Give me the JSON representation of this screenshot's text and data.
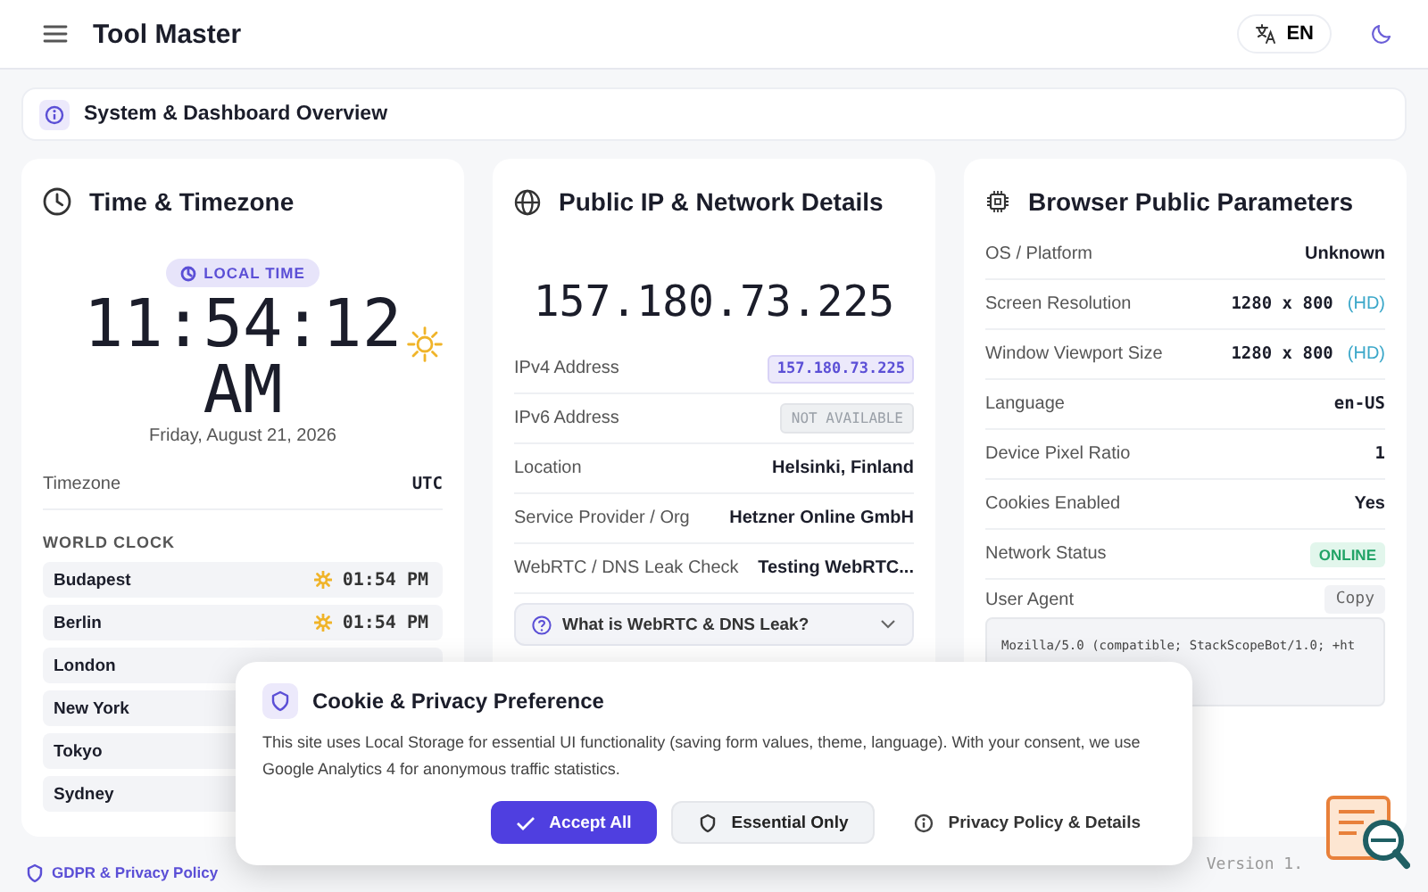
{
  "header": {
    "title": "Tool Master",
    "language": "EN"
  },
  "overview": {
    "title": "System & Dashboard Overview"
  },
  "time_card": {
    "title": "Time & Timezone",
    "badge": "LOCAL TIME",
    "time": "11:54:12",
    "period": "AM",
    "date": "Friday, August 21, 2026",
    "timezone_label": "Timezone",
    "timezone_value": "UTC",
    "world_clock_title": "WORLD CLOCK",
    "cities": [
      {
        "name": "Budapest",
        "time": "01:54 PM"
      },
      {
        "name": "Berlin",
        "time": "01:54 PM"
      },
      {
        "name": "London"
      },
      {
        "name": "New York"
      },
      {
        "name": "Tokyo"
      },
      {
        "name": "Sydney"
      }
    ]
  },
  "ip_card": {
    "title": "Public IP & Network Details",
    "ip": "157.180.73.225",
    "rows": [
      {
        "label": "IPv4 Address",
        "value": "157.180.73.225",
        "kind": "badge"
      },
      {
        "label": "IPv6 Address",
        "value": "NOT AVAILABLE",
        "kind": "muted"
      },
      {
        "label": "Location",
        "value": "Helsinki, Finland",
        "kind": "text"
      },
      {
        "label": "Service Provider / Org",
        "value": "Hetzner Online GmbH",
        "kind": "text"
      },
      {
        "label": "WebRTC / DNS Leak Check",
        "value": "Testing WebRTC...",
        "kind": "text"
      }
    ],
    "faq": {
      "question": "What is WebRTC & DNS Leak?",
      "expanded": false
    }
  },
  "browser_card": {
    "title": "Browser Public Parameters",
    "rows": [
      {
        "label": "OS / Platform",
        "value": "Unknown",
        "kind": "text"
      },
      {
        "label": "Screen Resolution",
        "value": "1280 x 800",
        "suffix": "(HD)",
        "kind": "mono"
      },
      {
        "label": "Window Viewport Size",
        "value": "1280 x 800",
        "suffix": "(HD)",
        "kind": "mono"
      },
      {
        "label": "Language",
        "value": "en-US",
        "kind": "mono"
      },
      {
        "label": "Device Pixel Ratio",
        "value": "1",
        "kind": "mono"
      },
      {
        "label": "Cookies Enabled",
        "value": "Yes",
        "kind": "text"
      },
      {
        "label": "Network Status",
        "value": "ONLINE",
        "kind": "status"
      }
    ],
    "user_agent": {
      "label": "User Agent",
      "copy": "Copy",
      "text": "Mozilla/5.0 (compatible; StackScopeBot/1.0; +ht"
    }
  },
  "cookie_dialog": {
    "title": "Cookie & Privacy Preference",
    "text": "This site uses Local Storage for essential UI functionality (saving form values, theme, language). With your consent, we use Google Analytics 4 for anonymous traffic statistics.",
    "buttons": [
      {
        "label": "Accept All",
        "kind": "primary"
      },
      {
        "label": "Essential Only",
        "kind": "secondary"
      },
      {
        "label": "Privacy Policy & Details",
        "kind": "link"
      }
    ]
  },
  "footer": {
    "policy_link": "GDPR & Privacy Policy",
    "version": "Version 1."
  }
}
